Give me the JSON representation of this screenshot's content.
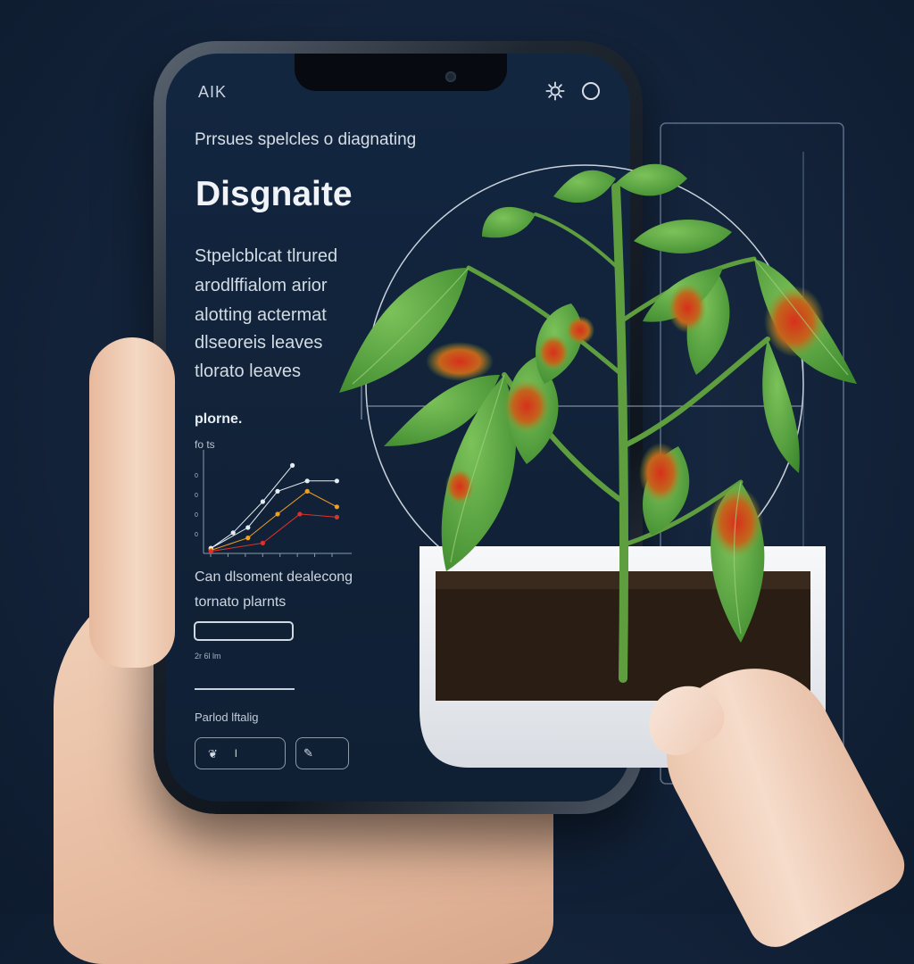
{
  "app": {
    "label": "AIK"
  },
  "header": {
    "subtitle": "Prrsues spelcles o diagnating",
    "title": "Disgnaite"
  },
  "description": [
    "Stpelcblcat tlrured",
    "arodlffialom arior",
    "alotting actermat",
    "dlseoreis leaves",
    "tlorato leaves"
  ],
  "chart_section": {
    "label": "plorne.",
    "sub_label": "fo ts"
  },
  "chart_data": {
    "type": "line",
    "title": "",
    "xlabel": "",
    "ylabel": "",
    "xlim": [
      0,
      10
    ],
    "ylim": [
      0,
      10
    ],
    "grid": false,
    "series": [
      {
        "color": "#e6ecf3",
        "values": [
          [
            0.5,
            0.5
          ],
          [
            2,
            2
          ],
          [
            4,
            5
          ],
          [
            6,
            8.5
          ]
        ]
      },
      {
        "color": "#e6ecf3",
        "values": [
          [
            0.5,
            0.5
          ],
          [
            3,
            2.5
          ],
          [
            5,
            6
          ],
          [
            7,
            7
          ],
          [
            9,
            7
          ]
        ]
      },
      {
        "color": "#f0a020",
        "values": [
          [
            0.5,
            0.3
          ],
          [
            3,
            1.5
          ],
          [
            5,
            3.8
          ],
          [
            7,
            6
          ],
          [
            9,
            4.5
          ]
        ]
      },
      {
        "color": "#e0302a",
        "values": [
          [
            0.5,
            0.2
          ],
          [
            4,
            1
          ],
          [
            6.5,
            3.8
          ],
          [
            9,
            3.5
          ]
        ]
      }
    ],
    "x_ticks": [
      "",
      "",
      "",
      "",
      "",
      "",
      "",
      ""
    ],
    "y_ticks": [
      "0",
      "0",
      "0",
      "0"
    ]
  },
  "captions": {
    "line1": "Can dlsoment dealecong",
    "line2": "tornato plarnts"
  },
  "meta": {
    "text": "2r 6l lm"
  },
  "footer": {
    "label": "Parlod lftalig",
    "button_a_text": "l"
  },
  "icons": {
    "settings": "gear-icon",
    "profile": "circle-icon",
    "leaf": "leaf-icon",
    "edit": "pencil-icon"
  },
  "colors": {
    "background": "#13233a",
    "screen": "#132640",
    "leaf_green": "#4f9a3a",
    "disease_red": "#c0391f",
    "tray_white": "#f2f3f5"
  }
}
